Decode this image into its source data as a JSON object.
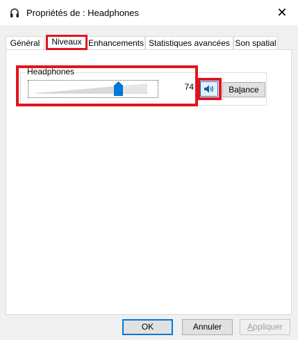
{
  "window": {
    "title": "Propriétés de : Headphones",
    "close_symbol": "✕"
  },
  "tabs": [
    {
      "label": "Général",
      "active": false
    },
    {
      "label": "Niveaux",
      "active": true
    },
    {
      "label": "Enhancements",
      "active": false
    },
    {
      "label": "Statistiques avancées",
      "active": false
    },
    {
      "label": "Son spatial",
      "active": false
    }
  ],
  "levels": {
    "device_label": "Headphones",
    "volume_value": "74",
    "volume_level_percent": 74,
    "mute_icon": "speaker-icon",
    "balance_label": "Balance"
  },
  "footer": {
    "ok_label": "OK",
    "cancel_label": "Annuler",
    "apply_label": "Appliquer"
  },
  "colors": {
    "highlight": "#e1141e",
    "accent": "#0078d7"
  }
}
